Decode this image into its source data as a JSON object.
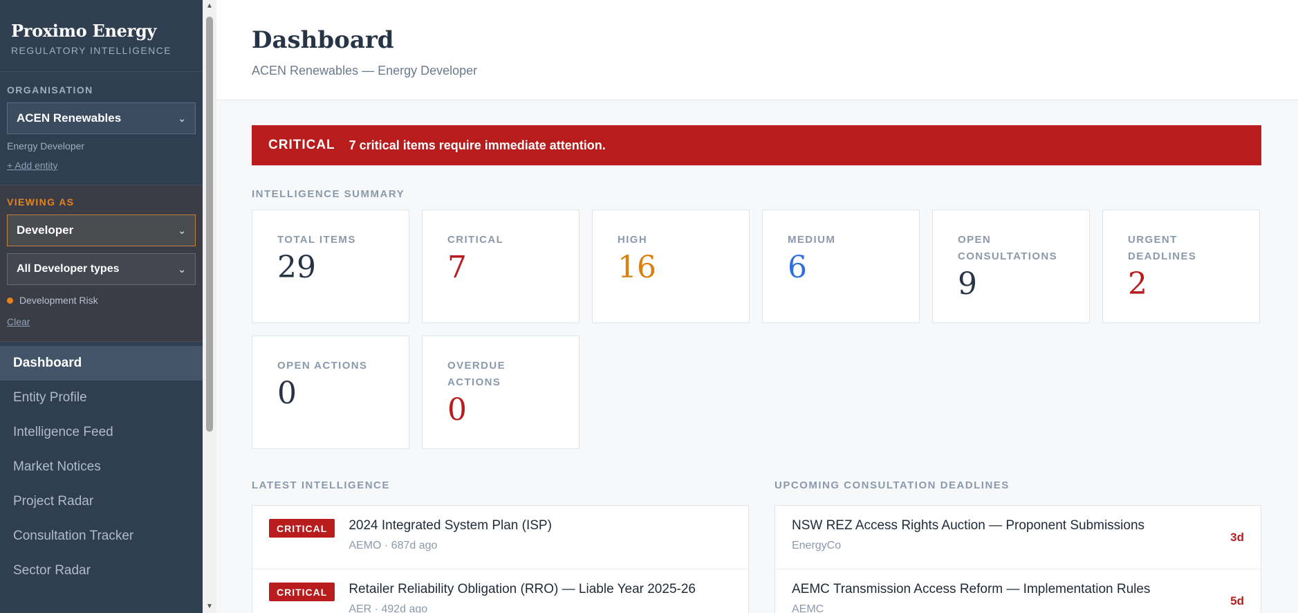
{
  "brand": {
    "title": "Proximo Energy",
    "subtitle": "REGULATORY INTELLIGENCE"
  },
  "organisation": {
    "label": "ORGANISATION",
    "selected": "ACEN Renewables",
    "type": "Energy Developer",
    "add_link": "+ Add entity"
  },
  "viewing": {
    "label": "VIEWING AS",
    "role": "Developer",
    "subtype": "All Developer types",
    "filter": "Development Risk",
    "clear": "Clear"
  },
  "nav": {
    "items": [
      {
        "label": "Dashboard"
      },
      {
        "label": "Entity Profile"
      },
      {
        "label": "Intelligence Feed"
      },
      {
        "label": "Market Notices"
      },
      {
        "label": "Project Radar"
      },
      {
        "label": "Consultation Tracker"
      },
      {
        "label": "Sector Radar"
      }
    ]
  },
  "header": {
    "title": "Dashboard",
    "subtitle": "ACEN Renewables — Energy Developer"
  },
  "alert": {
    "tag": "CRITICAL",
    "message": "7 critical items require immediate attention."
  },
  "summary": {
    "label": "INTELLIGENCE SUMMARY",
    "cards": [
      {
        "label": "TOTAL ITEMS",
        "value": "29"
      },
      {
        "label": "CRITICAL",
        "value": "7"
      },
      {
        "label": "HIGH",
        "value": "16"
      },
      {
        "label": "MEDIUM",
        "value": "6"
      },
      {
        "label": "OPEN CONSULTATIONS",
        "value": "9"
      },
      {
        "label": "URGENT DEADLINES",
        "value": "2"
      },
      {
        "label": "OPEN ACTIONS",
        "value": "0"
      },
      {
        "label": "OVERDUE ACTIONS",
        "value": "0"
      }
    ]
  },
  "latest": {
    "label": "LATEST INTELLIGENCE",
    "items": [
      {
        "badge": "CRITICAL",
        "title": "2024 Integrated System Plan (ISP)",
        "meta": "AEMO · 687d ago"
      },
      {
        "badge": "CRITICAL",
        "title": "Retailer Reliability Obligation (RRO) — Liable Year 2025-26",
        "meta": "AER · 492d ago"
      }
    ]
  },
  "deadlines": {
    "label": "UPCOMING CONSULTATION DEADLINES",
    "items": [
      {
        "title": "NSW REZ Access Rights Auction — Proponent Submissions",
        "meta": "EnergyCo",
        "days": "3d"
      },
      {
        "title": "AEMC Transmission Access Reform — Implementation Rules",
        "meta": "AEMC",
        "days": "5d"
      }
    ]
  },
  "colors": {
    "critical": "#b91c1c",
    "high": "#d9800e",
    "medium": "#2f6fe0",
    "sidebar": "#2f3e50",
    "accent": "#e8821c"
  }
}
